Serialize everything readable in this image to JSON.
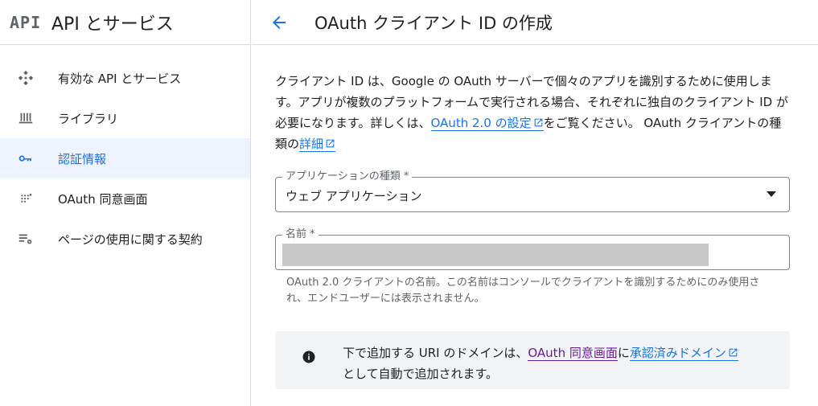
{
  "sidebar": {
    "logo": "API",
    "title": "API とサービス",
    "items": [
      {
        "label": "有効な API とサービス",
        "icon": "api-diamond-icon"
      },
      {
        "label": "ライブラリ",
        "icon": "library-icon"
      },
      {
        "label": "認証情報",
        "icon": "key-icon",
        "active": true
      },
      {
        "label": "OAuth 同意画面",
        "icon": "consent-dots-icon"
      },
      {
        "label": "ページの使用に関する契約",
        "icon": "settings-list-icon"
      }
    ]
  },
  "header": {
    "title": "OAuth クライアント ID の作成"
  },
  "main": {
    "description": {
      "part1": "クライアント ID は、Google の OAuth サーバーで個々のアプリを識別するために使用します。アプリが複数のプラットフォームで実行される場合、それぞれに独自のクライアント ID が必要になります。詳しくは、",
      "link1": "OAuth 2.0 の設定",
      "part2": "をご覧ください。 OAuth クライアントの種類の",
      "link2": "詳細"
    },
    "app_type": {
      "label": "アプリケーションの種類 *",
      "value": "ウェブ アプリケーション"
    },
    "name_field": {
      "label": "名前 *",
      "value": "",
      "helper": "OAuth 2.0 クライアントの名前。この名前はコンソールでクライアントを識別するためにのみ使用され、エンドユーザーには表示されません。"
    },
    "info": {
      "part1": "下で追加する URI のドメインは、",
      "link1": "OAuth 同意画面",
      "part2": "に",
      "link2": "承認済みドメイン",
      "part3": "として自動で追加されます。"
    }
  },
  "colors": {
    "accent": "#1a73e8",
    "active_bg": "#eef3fd",
    "visited_link": "#6a1b9a",
    "info_bg": "#f1f3f4"
  }
}
